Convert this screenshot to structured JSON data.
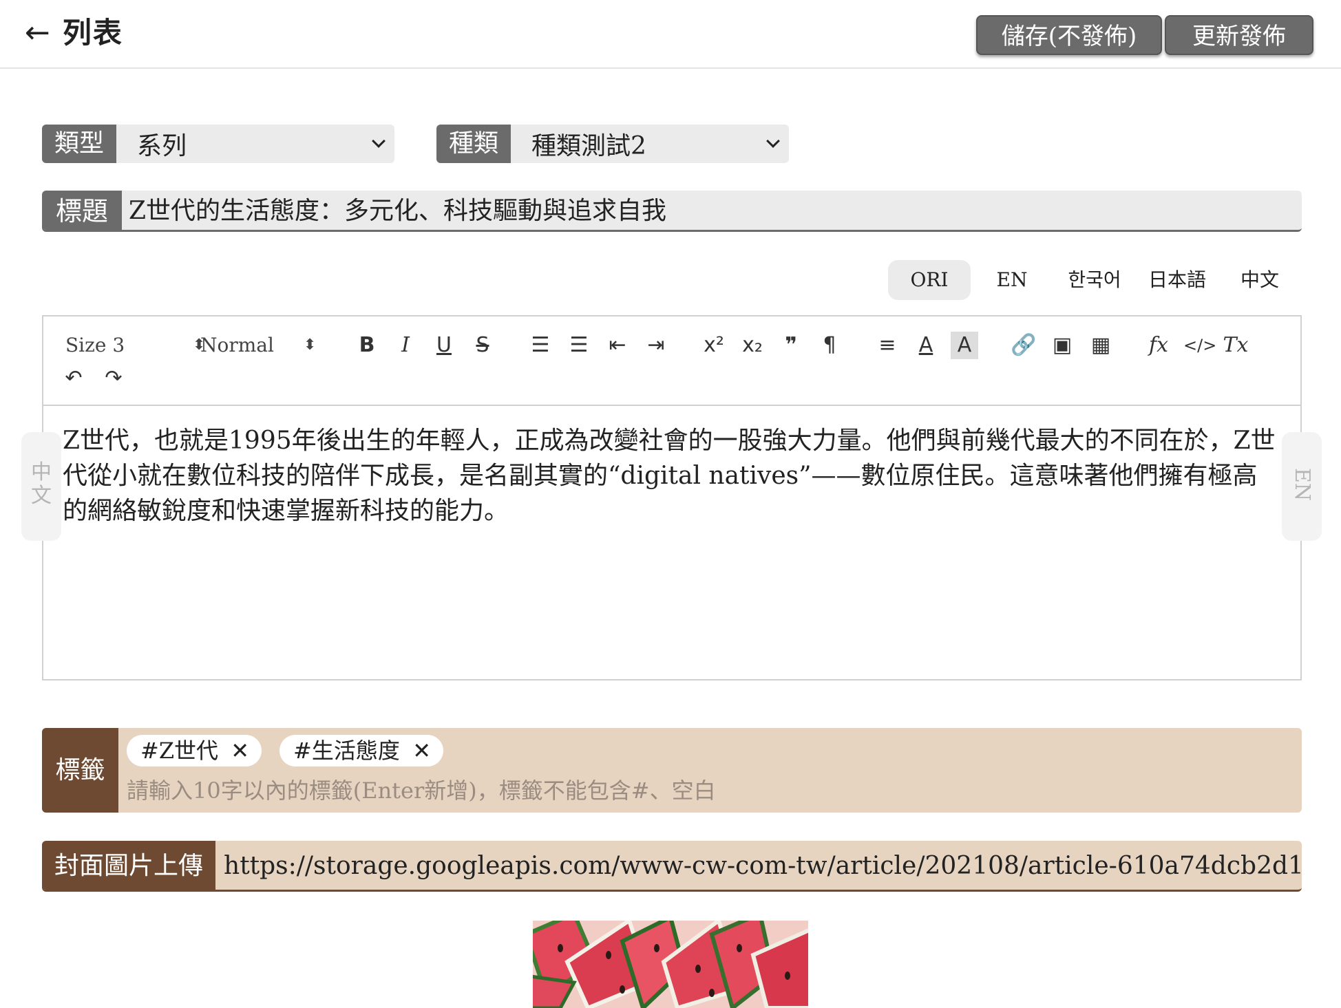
{
  "header": {
    "back_label": "列表",
    "save_draft_label": "儲存(不發佈)",
    "publish_label": "更新發佈"
  },
  "form": {
    "type_label": "類型",
    "type_value": "系列",
    "kind_label": "種類",
    "kind_value": "種類測試2",
    "title_label": "標題",
    "title_value": "Z世代的生活態度：多元化、科技驅動與追求自我"
  },
  "languages": [
    {
      "label": "ORI",
      "active": true
    },
    {
      "label": "EN",
      "active": false
    },
    {
      "label": "한국어",
      "active": false
    },
    {
      "label": "日本語",
      "active": false
    },
    {
      "label": "中文",
      "active": false
    }
  ],
  "toolbar": {
    "size_value": "Size 3",
    "format_value": "Normal"
  },
  "editor": {
    "lines": [
      "Z世代，也就是1995年後出生的年輕人，正成為改變社會的一股強大力量。他們與前幾代最大的不同在於，Z世",
      "代從小就在數位科技的陪伴下成長，是名副其實的“digital natives”——數位原住民。這意味著他們擁有極高",
      "的網絡敏銳度和快速掌握新科技的能力。"
    ],
    "left_side_label": "中文",
    "right_side_label": "EN"
  },
  "tags": {
    "label": "標籤",
    "chips": [
      "#Z世代",
      "#生活態度"
    ],
    "input_placeholder": "請輸入10字以內的標籤(Enter新增)，標籤不能包含#、空白"
  },
  "cover": {
    "label": "封面圖片上傳",
    "url": "https://storage.googleapis.com/www-cw-com-tw/article/202108/article-610a74dcb2d13.jpg"
  },
  "colors": {
    "header_button": "#6b6b6b",
    "tag_bg": "#e6d4c1",
    "tag_label_bg": "#6e4a32"
  }
}
